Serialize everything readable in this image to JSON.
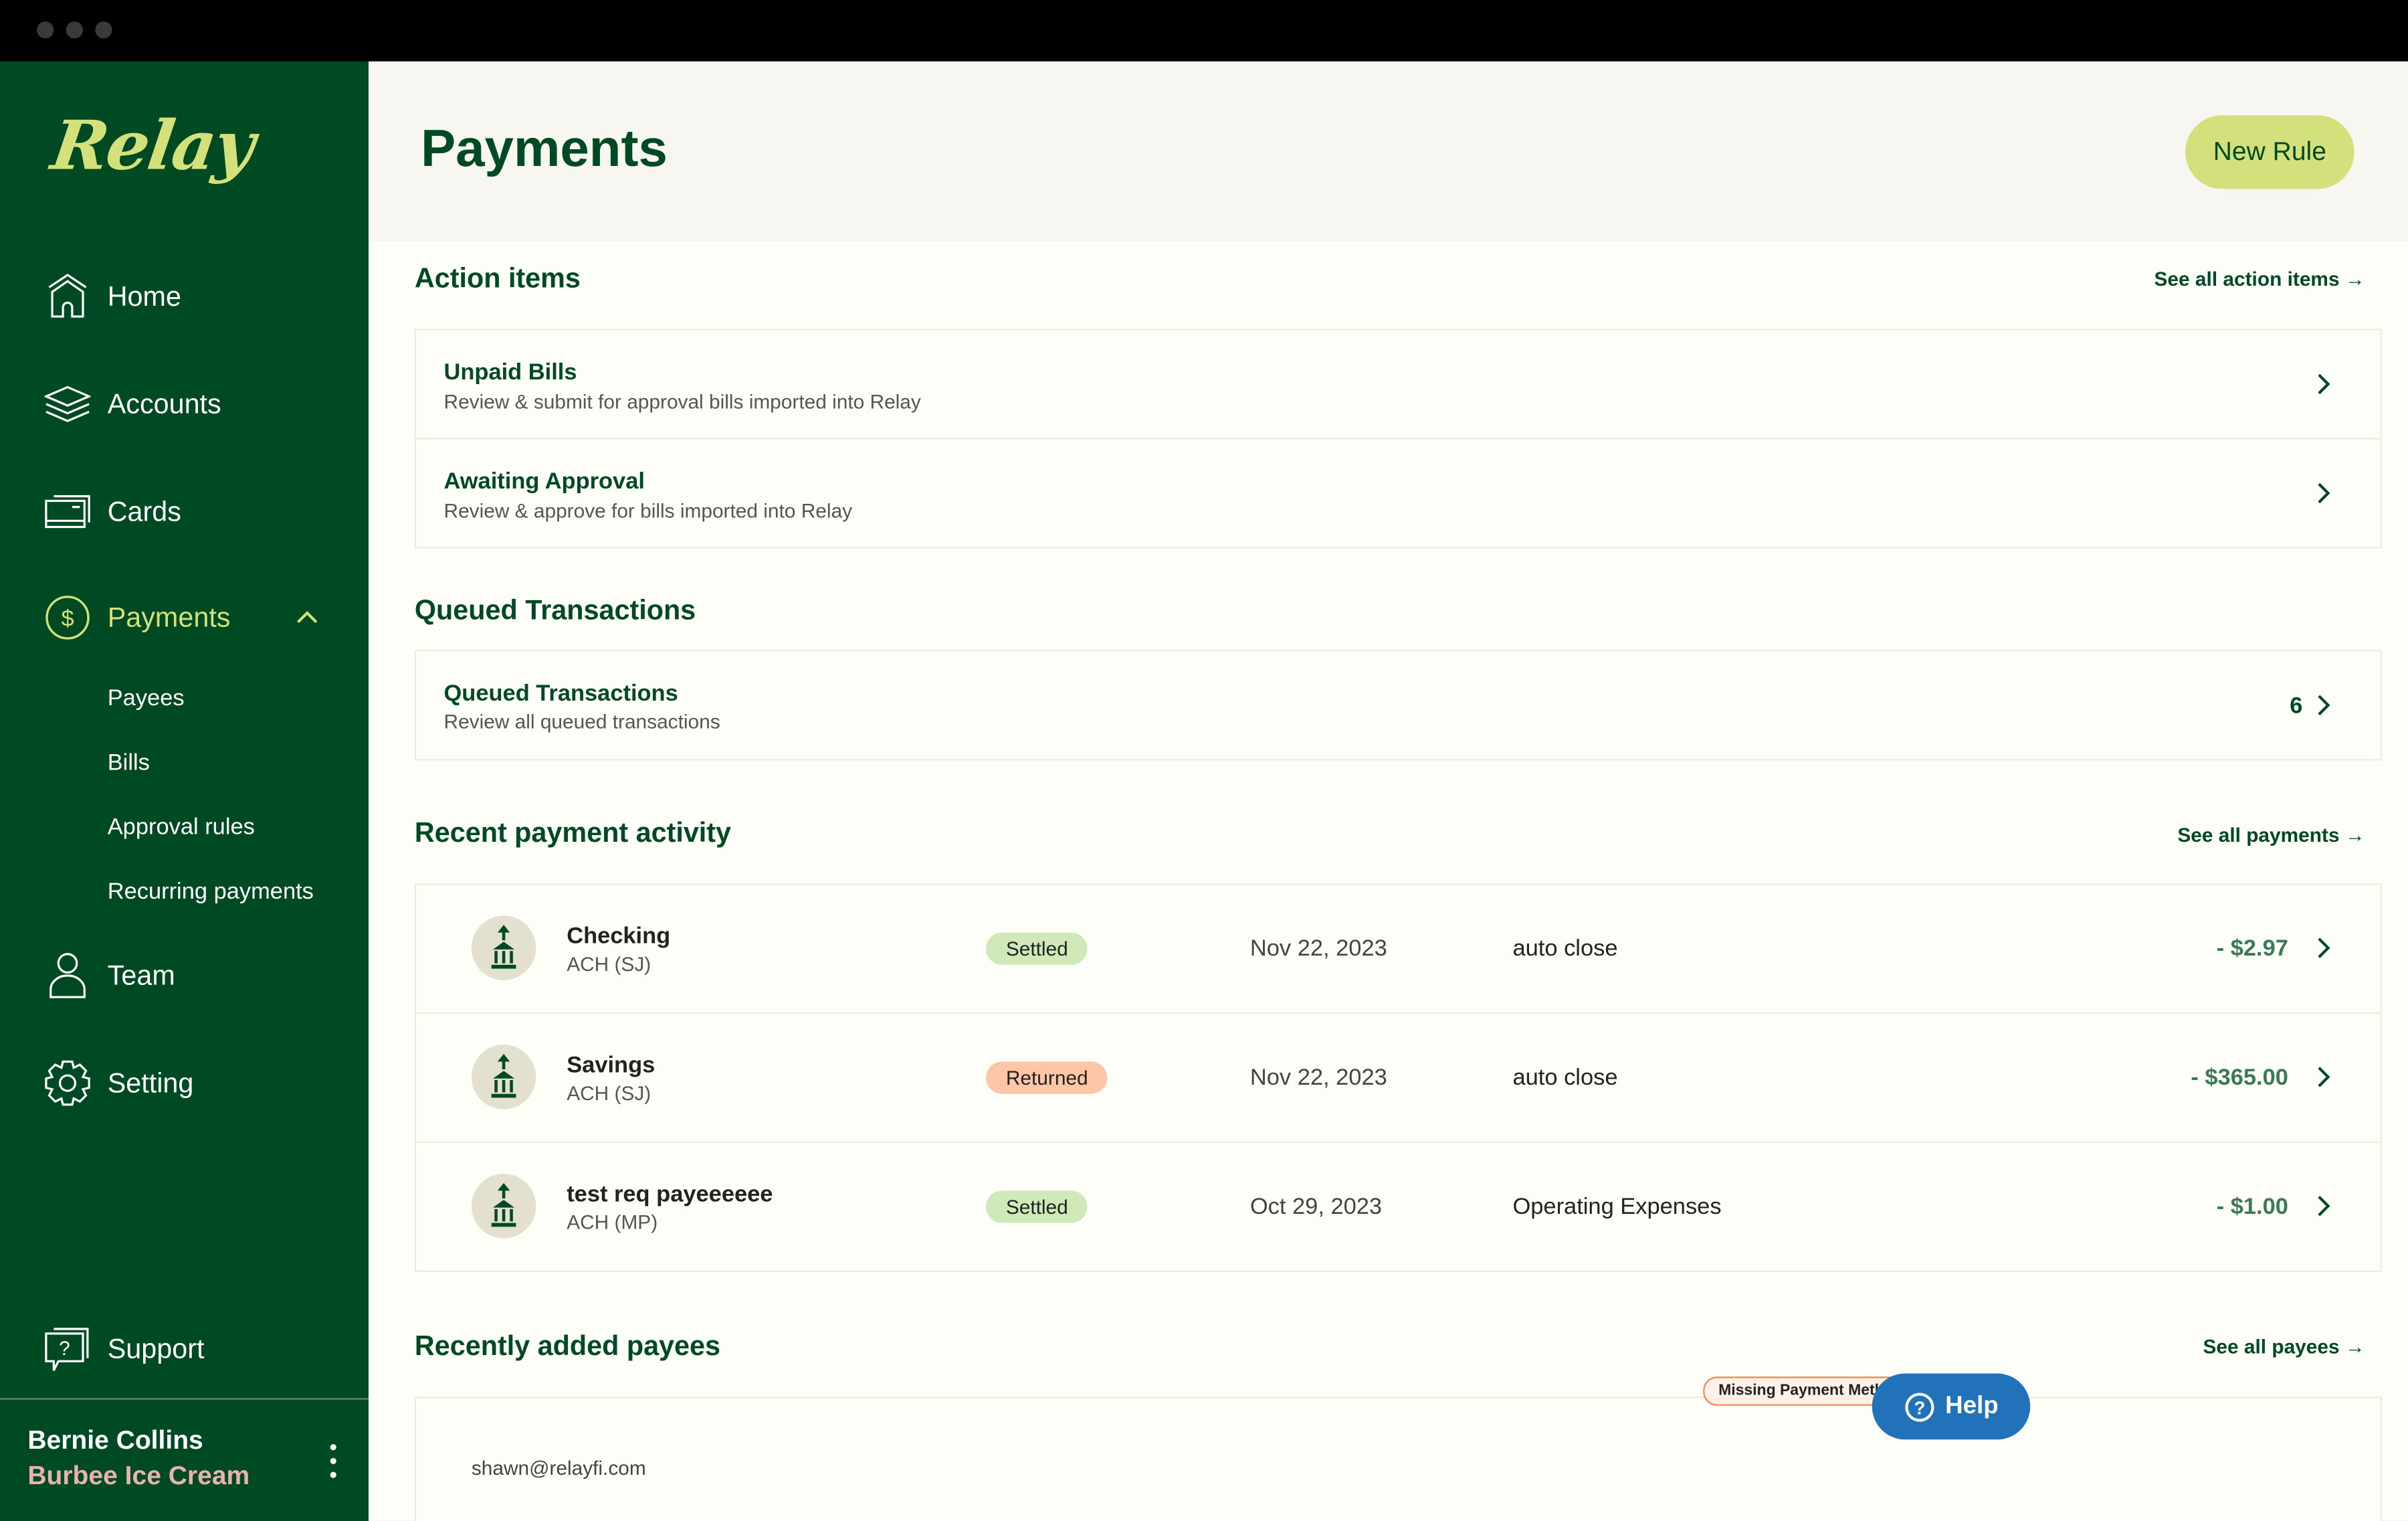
{
  "window": {
    "controls": [
      "close",
      "minimize",
      "maximize"
    ]
  },
  "sidebar": {
    "logo": "Relay",
    "items": [
      {
        "label": "Home",
        "icon": "home-icon"
      },
      {
        "label": "Accounts",
        "icon": "layers-icon"
      },
      {
        "label": "Cards",
        "icon": "cards-icon"
      },
      {
        "label": "Payments",
        "icon": "dollar-circle-icon",
        "active": true,
        "expanded": true
      },
      {
        "label": "Team",
        "icon": "person-icon"
      },
      {
        "label": "Setting",
        "icon": "gear-icon"
      }
    ],
    "payments_submenu": [
      "Payees",
      "Bills",
      "Approval rules",
      "Recurring payments"
    ],
    "support": {
      "label": "Support",
      "icon": "support-chat-icon"
    },
    "user": {
      "name": "Bernie Collins",
      "organization": "Burbee Ice Cream"
    }
  },
  "header": {
    "title": "Payments",
    "new_rule_label": "New Rule"
  },
  "action_items": {
    "title": "Action items",
    "see_all": "See all action items →",
    "rows": [
      {
        "title": "Unpaid Bills",
        "subtitle": "Review & submit for approval bills imported into Relay"
      },
      {
        "title": "Awaiting Approval",
        "subtitle": "Review & approve for bills imported into Relay"
      }
    ]
  },
  "queued": {
    "title": "Queued Transactions",
    "row": {
      "title": "Queued Transactions",
      "subtitle": "Review all queued transactions",
      "count": "6"
    }
  },
  "recent_activity": {
    "title": "Recent payment activity",
    "see_all": "See all payments →",
    "rows": [
      {
        "name": "Checking",
        "method": "ACH (SJ)",
        "status": "Settled",
        "date": "Nov 22, 2023",
        "memo": "auto close",
        "amount": "- $2.97"
      },
      {
        "name": "Savings",
        "method": "ACH (SJ)",
        "status": "Returned",
        "date": "Nov 22, 2023",
        "memo": "auto close",
        "amount": "- $365.00"
      },
      {
        "name": "test req payeeeeee",
        "method": "ACH (MP)",
        "status": "Settled",
        "date": "Oct 29, 2023",
        "memo": "Operating Expenses",
        "amount": "- $1.00"
      }
    ]
  },
  "recent_payees": {
    "title": "Recently added payees",
    "see_all": "See all payees →",
    "rows": [
      {
        "email": "shawn@relayfi.com",
        "badge": "Missing Payment Method"
      }
    ]
  },
  "help": {
    "label": "Help"
  },
  "colors": {
    "sidebar_bg": "#004a23",
    "accent_lime": "#d4e07c",
    "brand_green": "#004a23",
    "settled": "#cfe9b8",
    "returned": "#fdc6a6",
    "amount": "#3b7a57",
    "help_blue": "#2272b9",
    "org_pink": "#e8b3ab"
  }
}
